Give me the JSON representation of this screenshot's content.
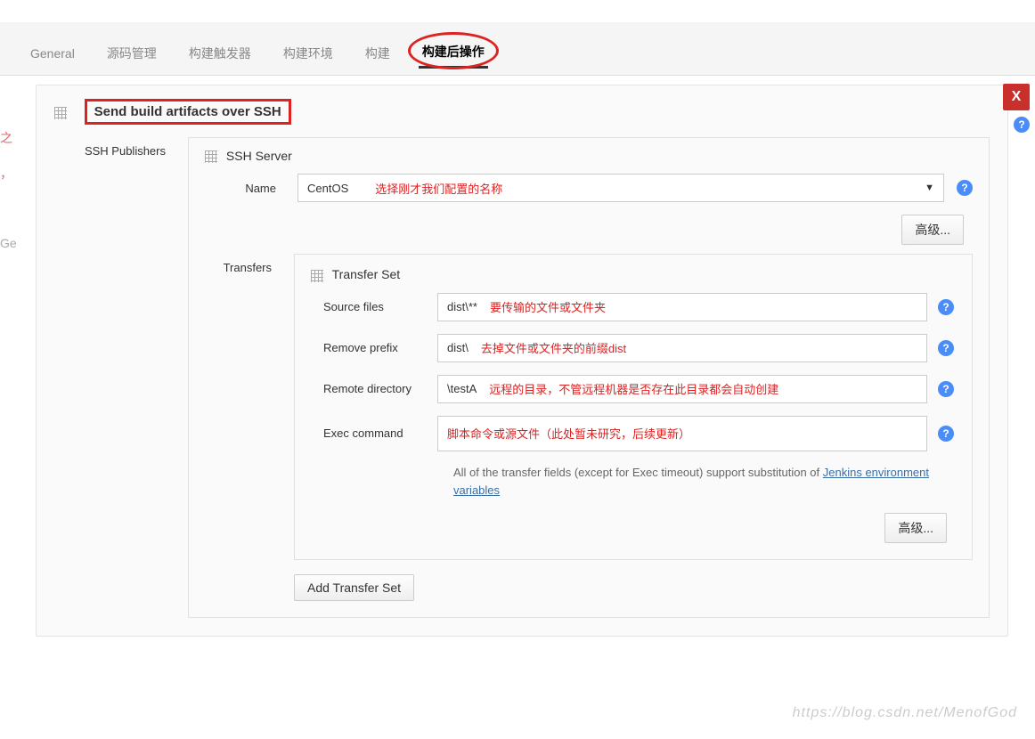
{
  "tabs": {
    "general": "General",
    "scm": "源码管理",
    "triggers": "构建触发器",
    "env": "构建环境",
    "build": "构建",
    "post": "构建后操作"
  },
  "close_label": "X",
  "panel": {
    "title": "Send build artifacts over SSH",
    "ssh_publishers_label": "SSH Publishers",
    "server_header": "SSH Server",
    "name_label": "Name",
    "name_value": "CentOS",
    "name_anno": "选择刚才我们配置的名称",
    "advanced_btn": "高级...",
    "transfers_label": "Transfers",
    "transfer_set_header": "Transfer Set",
    "fields": {
      "source": {
        "label": "Source files",
        "value": "dist\\**",
        "anno": "要传输的文件或文件夹"
      },
      "remove": {
        "label": "Remove prefix",
        "value": "dist\\",
        "anno": "去掉文件或文件夹的前缀dist"
      },
      "remote": {
        "label": "Remote directory",
        "value": "\\testA",
        "anno": "远程的目录，不管远程机器是否存在此目录都会自动创建"
      },
      "exec": {
        "label": "Exec command",
        "value": "",
        "anno": "脚本命令或源文件（此处暂未研究，后续更新）"
      }
    },
    "hint_pre": "All of the transfer fields (except for Exec timeout) support substitution of ",
    "hint_link": "Jenkins environment variables",
    "add_ts": "Add Transfer Set"
  },
  "watermark": "https://blog.csdn.net/MenofGod",
  "left_frag1": "之",
  "left_frag2": "，",
  "left_frag3": "Ge"
}
